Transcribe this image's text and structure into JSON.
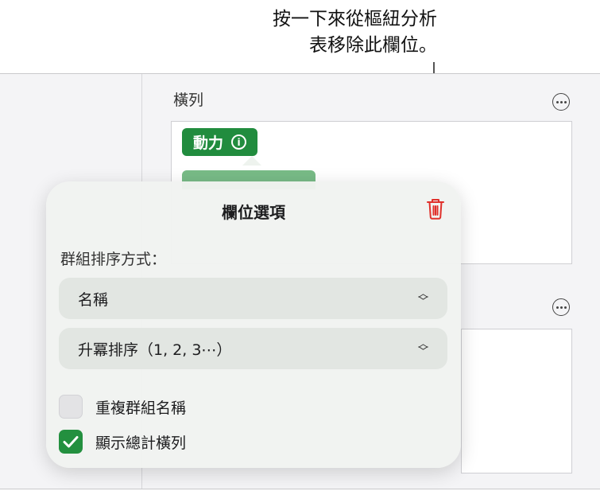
{
  "callout": {
    "line1": "按一下來從樞紐分析",
    "line2": "表移除此欄位。"
  },
  "sidebar": {
    "rows_title": "橫列"
  },
  "chip": {
    "label": "動力",
    "icon": "info-icon",
    "color": "#218c3e"
  },
  "popover": {
    "title": "欄位選項",
    "delete_icon": "trash-icon",
    "delete_color": "#e0302b",
    "group_sort_label": "群組排序方式：",
    "sort_by_value": "名稱",
    "sort_order_value": "升冪排序（1, 2, 3⋯）",
    "repeat_label": "重複群組名稱",
    "repeat_checked": false,
    "totals_label": "顯示總計橫列",
    "totals_checked": true,
    "accent": "#23903f"
  }
}
